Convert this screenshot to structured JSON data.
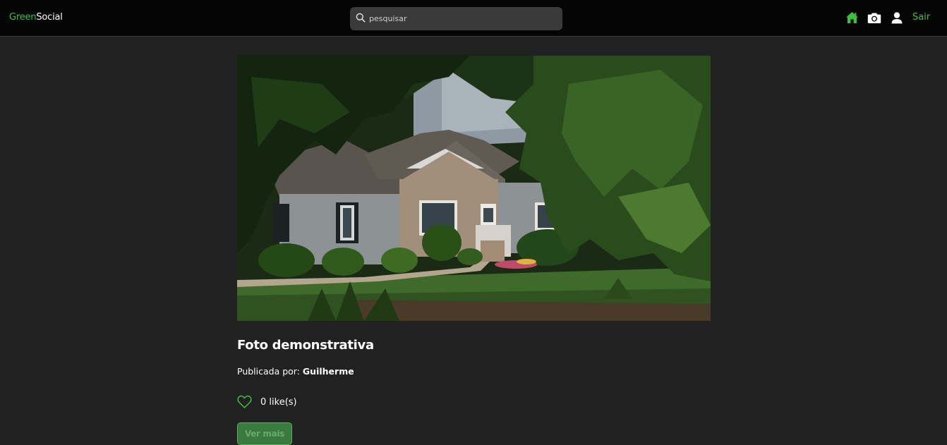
{
  "header": {
    "brand_green": "Green",
    "brand_white": "Social",
    "search_placeholder": "pesquisar",
    "nav_icons": [
      "home-icon",
      "camera-icon",
      "user-icon"
    ],
    "logout_label": "Sair"
  },
  "post": {
    "image_alt": "Foto demonstrativa",
    "title": "Foto demonstrativa",
    "published_prefix": "Publicada por:",
    "author": "Guilherme",
    "likes_label": "0 like(s)",
    "more_label": "Ver mais"
  },
  "colors": {
    "accent": "#3fbf3f",
    "topbar": "#050505",
    "background": "#212121",
    "button": "#3b7a3f"
  }
}
